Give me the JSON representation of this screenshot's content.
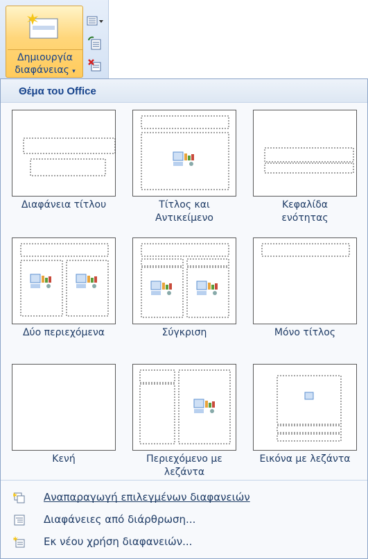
{
  "ribbon": {
    "new_slide_line1": "Δημιουργία",
    "new_slide_line2": "διαφάνειας",
    "dropdown_arrow": "▾",
    "side_buttons": [
      "layout-icon",
      "reset-icon",
      "delete-slide-icon"
    ]
  },
  "gallery": {
    "title": "Θέμα του Office",
    "layouts": [
      {
        "label": "Διαφάνεια τίτλου"
      },
      {
        "label": "Τίτλος και\nΑντικείμενο"
      },
      {
        "label": "Κεφαλίδα\nενότητας"
      },
      {
        "label": "Δύο περιεχόμενα"
      },
      {
        "label": "Σύγκριση"
      },
      {
        "label": "Μόνο τίτλος"
      },
      {
        "label": "Κενή"
      },
      {
        "label": "Περιεχόμενο με\nλεζάντα"
      },
      {
        "label": "Εικόνα με λεζάντα"
      }
    ]
  },
  "menu": {
    "duplicate": "Αναπαραγωγή επιλεγμένων διαφανειών",
    "from_outline": "Διαφάνειες από διάρθρωση...",
    "reuse": "Εκ νέου χρήση διαφανειών..."
  }
}
